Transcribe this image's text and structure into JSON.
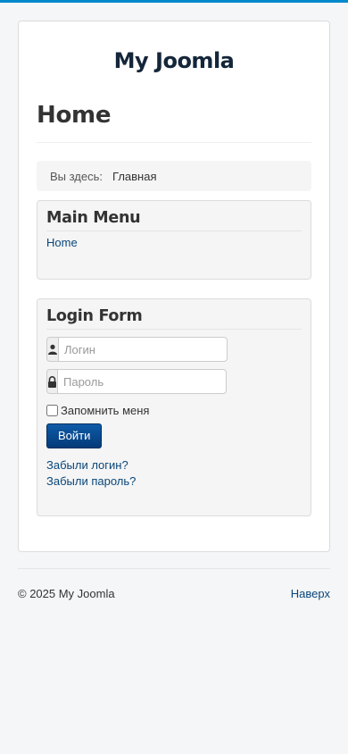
{
  "site": {
    "brand": "My Joomla"
  },
  "page": {
    "title": "Home"
  },
  "breadcrumb": {
    "here_label": "Вы здесь:",
    "current": "Главная"
  },
  "main_menu": {
    "title": "Main Menu",
    "items": [
      {
        "label": "Home"
      }
    ]
  },
  "login_form": {
    "title": "Login Form",
    "username_placeholder": "Логин",
    "password_placeholder": "Пароль",
    "remember_label": "Запомнить меня",
    "submit_label": "Войти",
    "forgot_username": "Забыли логин?",
    "forgot_password": "Забыли пароль?",
    "username_icon": "user-icon",
    "password_icon": "lock-icon"
  },
  "footer": {
    "copyright": "© 2025 My Joomla",
    "back_to_top": "Наверх"
  },
  "colors": {
    "accent_bar": "#0088cc",
    "link": "#08467a",
    "button": "#0e5ba8"
  }
}
